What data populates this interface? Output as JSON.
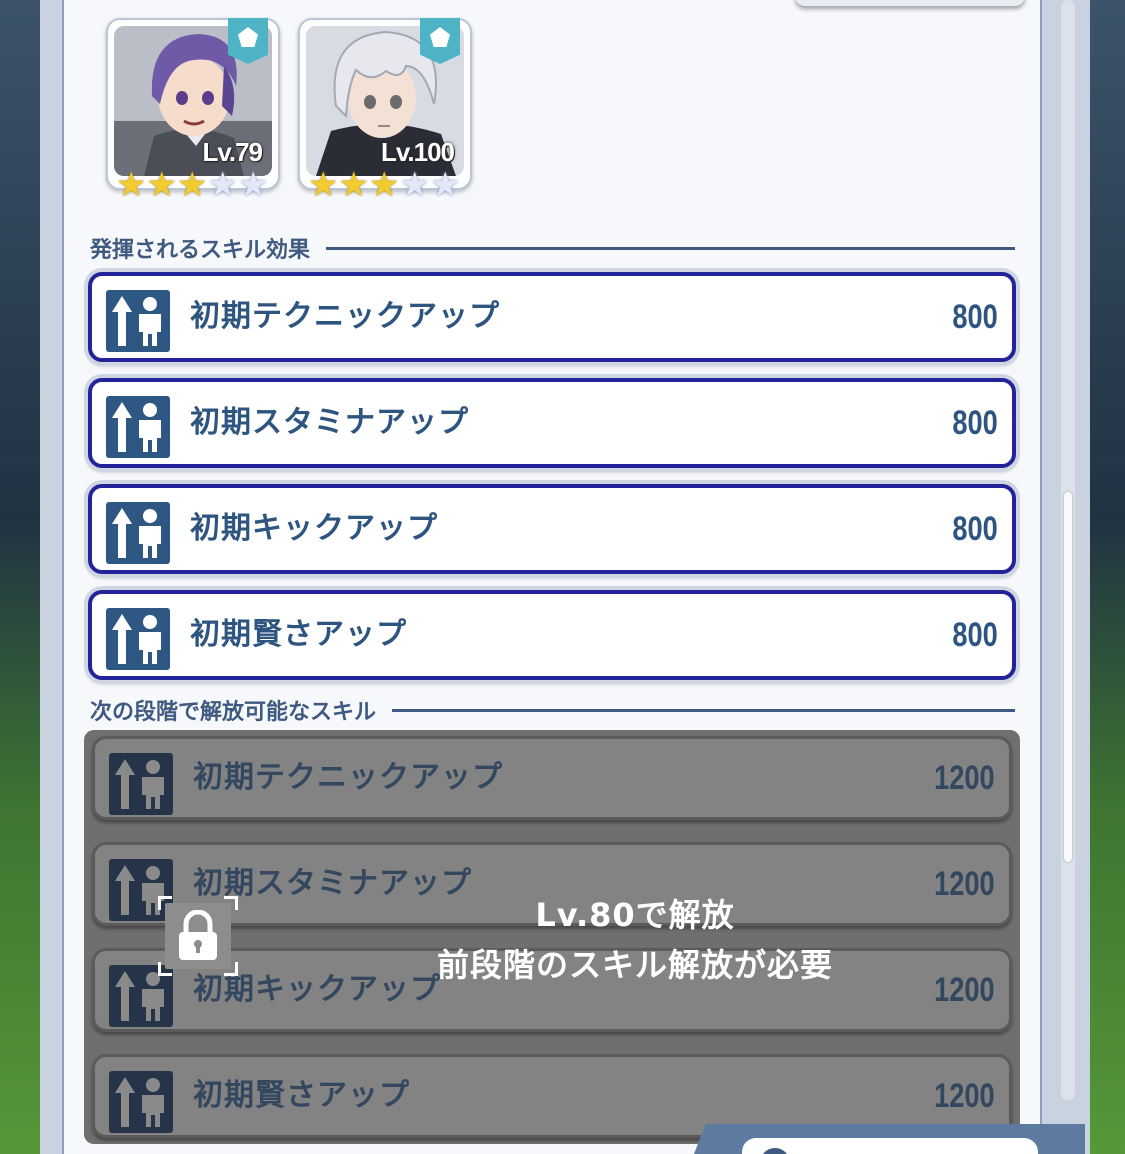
{
  "characters": [
    {
      "level": "Lv.79",
      "stars_filled": 3,
      "stars_total": 5,
      "hair_color": "#6f5aa8"
    },
    {
      "level": "Lv.100",
      "stars_filled": 3,
      "stars_total": 5,
      "hair_color": "#e6e8ee"
    }
  ],
  "sections": {
    "active_title": "発揮されるスキル効果",
    "next_title": "次の段階で解放可能なスキル"
  },
  "active_skills": [
    {
      "name": "初期テクニックアップ",
      "value": "800"
    },
    {
      "name": "初期スタミナアップ",
      "value": "800"
    },
    {
      "name": "初期キックアップ",
      "value": "800"
    },
    {
      "name": "初期賢さアップ",
      "value": "800"
    }
  ],
  "next_skills": [
    {
      "name": "初期テクニックアップ",
      "value": "1200"
    },
    {
      "name": "初期スタミナアップ",
      "value": "1200"
    },
    {
      "name": "初期キックアップ",
      "value": "1200"
    },
    {
      "name": "初期賢さアップ",
      "value": "1200"
    }
  ],
  "lock": {
    "line1": "Lv.80で解放",
    "line2": "前段階のスキル解放が必要"
  },
  "colors": {
    "accent": "#3f5a80",
    "skill_border": "#23239a",
    "icon_bg": "#2f5783",
    "badge": "#4fb3c6"
  }
}
